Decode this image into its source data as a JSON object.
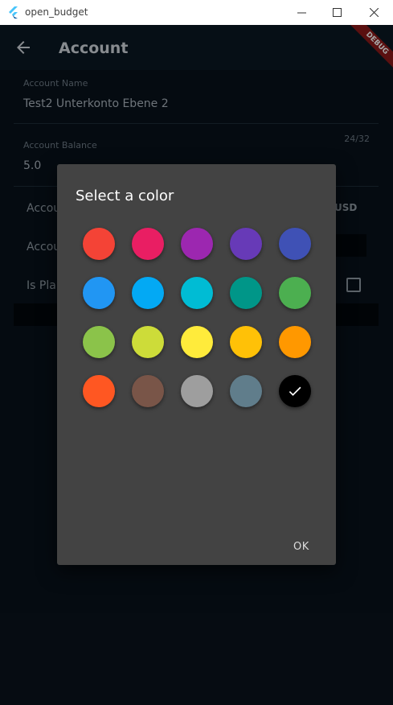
{
  "window": {
    "title": "open_budget"
  },
  "appbar": {
    "title": "Account",
    "debug_label": "DEBUG"
  },
  "form": {
    "account_name": {
      "label": "Account Name",
      "value": "Test2 Unterkonto Ebene 2"
    },
    "account_balance": {
      "label": "Account Balance",
      "value": "5.0",
      "counter": "24/32"
    },
    "currency_row": {
      "label": "Accou",
      "value": "USD"
    },
    "account_row": {
      "label": "Accou"
    },
    "placeholder_row": {
      "label": "Is Pla"
    }
  },
  "dialog": {
    "title": "Select a color",
    "ok_label": "OK",
    "colors": [
      "#f44336",
      "#e91e63",
      "#9c27b0",
      "#673ab7",
      "#3f51b5",
      "#2196f3",
      "#03a9f4",
      "#00bcd4",
      "#009688",
      "#4caf50",
      "#8bc34a",
      "#cddc39",
      "#ffeb3b",
      "#ffc107",
      "#ff9800",
      "#ff5722",
      "#795548",
      "#9e9e9e",
      "#607d8b",
      "#000000"
    ],
    "selected_index": 19
  }
}
